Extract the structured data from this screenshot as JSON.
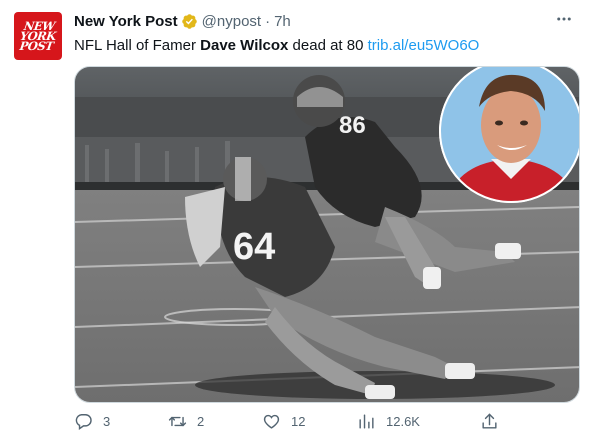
{
  "account": {
    "avatar_text_lines": [
      "NEW",
      "YORK",
      "POST"
    ],
    "display_name": "New York Post",
    "handle": "@nypost",
    "separator": "·",
    "time": "7h",
    "verified_color": "#e2b719"
  },
  "tweet": {
    "text_before": "NFL Hall of Famer ",
    "text_bold": "Dave Wilcox",
    "text_after": " dead at 80 ",
    "link": "trib.al/eu5WO6O",
    "link_color": "#1d9bf0"
  },
  "media": {
    "jersey_number_front": "64",
    "jersey_number_back": "86",
    "inset_jersey_color": "#c8202a"
  },
  "actions": {
    "replies": "3",
    "retweets": "2",
    "likes": "12",
    "views": "12.6K"
  },
  "icons": [
    "more-icon",
    "verified-badge-icon",
    "reply-icon",
    "retweet-icon",
    "like-icon",
    "views-icon",
    "share-icon"
  ]
}
